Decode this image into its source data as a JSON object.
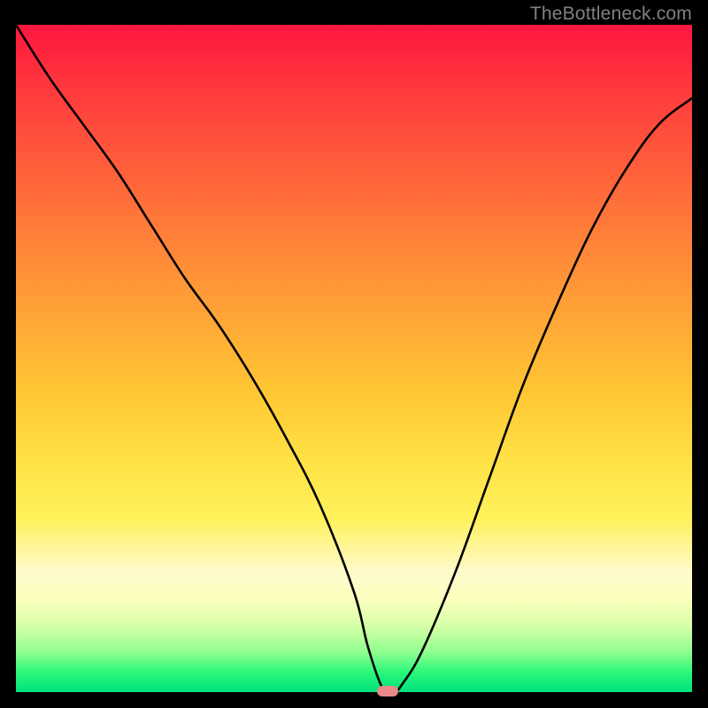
{
  "watermark": "TheBottleneck.com",
  "colors": {
    "gradient_top": "#ff163f",
    "gradient_bottom": "#00e27e",
    "curve": "#000000",
    "dot": "#e98a88",
    "frame": "#000000"
  },
  "chart_data": {
    "type": "line",
    "title": "",
    "xlabel": "",
    "ylabel": "",
    "xlim": [
      0,
      100
    ],
    "ylim": [
      0,
      100
    ],
    "x": [
      0,
      5,
      10,
      15,
      20,
      25,
      30,
      35,
      40,
      45,
      50,
      52,
      54,
      55,
      56,
      57,
      60,
      65,
      70,
      75,
      80,
      85,
      90,
      95,
      100
    ],
    "values": [
      100,
      92,
      85,
      78,
      70,
      62,
      55,
      47,
      38,
      28,
      15,
      7,
      1,
      0,
      0,
      1,
      6,
      18,
      32,
      46,
      58,
      69,
      78,
      85,
      89
    ],
    "minimum_x": 55,
    "gradient_meaning": "red = high bottleneck %, green = low bottleneck %"
  }
}
